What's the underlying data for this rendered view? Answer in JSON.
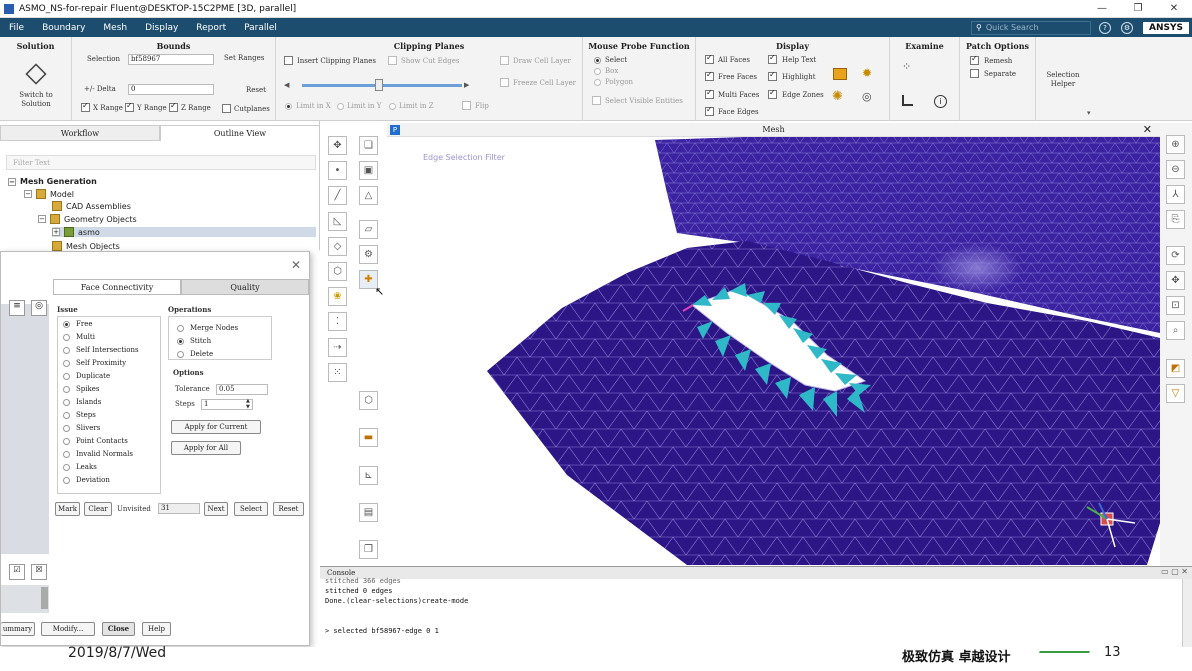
{
  "window": {
    "title": "ASMO_NS-for-repair Fluent@DESKTOP-15C2PME  [3D, parallel]",
    "controls": [
      "—",
      "❐",
      "✕"
    ]
  },
  "menu": {
    "items": [
      "File",
      "Boundary",
      "Mesh",
      "Display",
      "Report",
      "Parallel"
    ],
    "search_placeholder": "Quick Search",
    "brand": "ANSYS"
  },
  "ribbon": {
    "solution": {
      "header": "Solution",
      "label": "Switch to Solution"
    },
    "bounds": {
      "header": "Bounds",
      "selection_label": "Selection",
      "selection_value": "bf58967",
      "set_ranges": "Set Ranges",
      "delta_label": "+/- Delta",
      "delta_value": "0",
      "reset": "Reset",
      "x_range": "X Range",
      "y_range": "Y Range",
      "z_range": "Z Range",
      "cutplanes": "Cutplanes"
    },
    "clipping": {
      "header": "Clipping Planes",
      "insert": "Insert Clipping Planes",
      "show_cut_edges": "Show Cut Edges",
      "draw_cell_layer": "Draw Cell Layer",
      "freeze_cell_layer": "Freeze Cell Layer",
      "limit_x": "Limit in X",
      "limit_y": "Limit in Y",
      "limit_z": "Limit in Z",
      "flip": "Flip"
    },
    "probe": {
      "header": "Mouse Probe Function",
      "select": "Select",
      "box": "Box",
      "polygon": "Polygon",
      "select_visible": "Select Visible Entities"
    },
    "display": {
      "header": "Display",
      "all_faces": "All Faces",
      "free_faces": "Free Faces",
      "multi_faces": "Multi Faces",
      "face_edges": "Face Edges",
      "help_text": "Help Text",
      "highlight": "Highlight",
      "edge_zones": "Edge Zones"
    },
    "examine": {
      "header": "Examine"
    },
    "patch": {
      "header": "Patch Options",
      "remesh": "Remesh",
      "separate": "Separate"
    },
    "selection_helper": "Selection Helper"
  },
  "outline": {
    "tabs": [
      "Workflow",
      "Outline View"
    ],
    "filter_placeholder": "Filter Text",
    "tree": [
      "Mesh Generation",
      "Model",
      "CAD Assemblies",
      "Geometry Objects",
      "asmo",
      "Mesh Objects"
    ]
  },
  "dialog": {
    "tabs": [
      "Face Connectivity",
      "Quality"
    ],
    "issue_header": "Issue",
    "issues": [
      "Free",
      "Multi",
      "Self Intersections",
      "Self Proximity",
      "Duplicate",
      "Spikes",
      "Islands",
      "Steps",
      "Slivers",
      "Point Contacts",
      "Invalid Normals",
      "Leaks",
      "Deviation"
    ],
    "operations_header": "Operations",
    "operations": [
      "Merge Nodes",
      "Stitch",
      "Delete"
    ],
    "options_header": "Options",
    "tolerance_label": "Tolerance",
    "tolerance_value": "0.05",
    "steps_label": "Steps",
    "steps_value": "1",
    "apply_current": "Apply for Current",
    "apply_all": "Apply for All",
    "mark": "Mark",
    "clear": "Clear",
    "unvisited_label": "Unvisited",
    "unvisited_value": "31",
    "next": "Next",
    "select": "Select",
    "reset": "Reset",
    "summary": "ummary",
    "modify": "Modify...",
    "close": "Close",
    "help": "Help"
  },
  "graphics": {
    "title": "Mesh",
    "filter_text": "Edge Selection Filter",
    "badge": "P"
  },
  "console": {
    "header": "Console",
    "lines": [
      "stitched 366 edges",
      "stitched 0 edges",
      "Done.(clear-selections)create-mode",
      "> selected bf58967-edge 0 1"
    ]
  },
  "footer": {
    "date": "2019/8/7/Wed",
    "slogan": "极致仿真 卓越设计",
    "page": "13"
  },
  "colors": {
    "menubar": "#1c4d6e",
    "mesh": "#2c1585",
    "highlight": "#2eb8c8"
  }
}
